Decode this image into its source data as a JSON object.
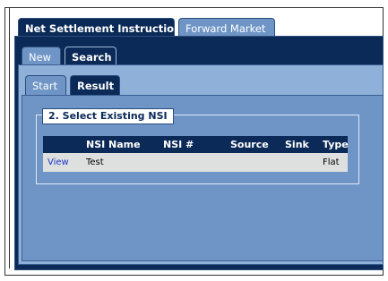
{
  "top_tabs": [
    {
      "label": "Net Settlement Instruction",
      "active": true
    },
    {
      "label": "Forward Market",
      "active": false
    }
  ],
  "mode_tabs": [
    {
      "label": "New",
      "active": false
    },
    {
      "label": "Search",
      "active": true
    }
  ],
  "step_tabs": [
    {
      "label": "Start",
      "active": false
    },
    {
      "label": "Result",
      "active": true
    }
  ],
  "section": {
    "title": "2. Select Existing NSI"
  },
  "table": {
    "columns": [
      "",
      "NSI Name",
      "NSI #",
      "Source",
      "Sink",
      "Type"
    ],
    "rows": [
      {
        "action": "View",
        "nsi_name": "Test",
        "nsi_num": "",
        "source": "",
        "sink": "",
        "type": "Flat"
      }
    ]
  },
  "colors": {
    "dark_navy": "#0b2a57",
    "mid_blue": "#6f95c6",
    "light_blue": "#8fb0d8",
    "link": "#1b37c9"
  }
}
